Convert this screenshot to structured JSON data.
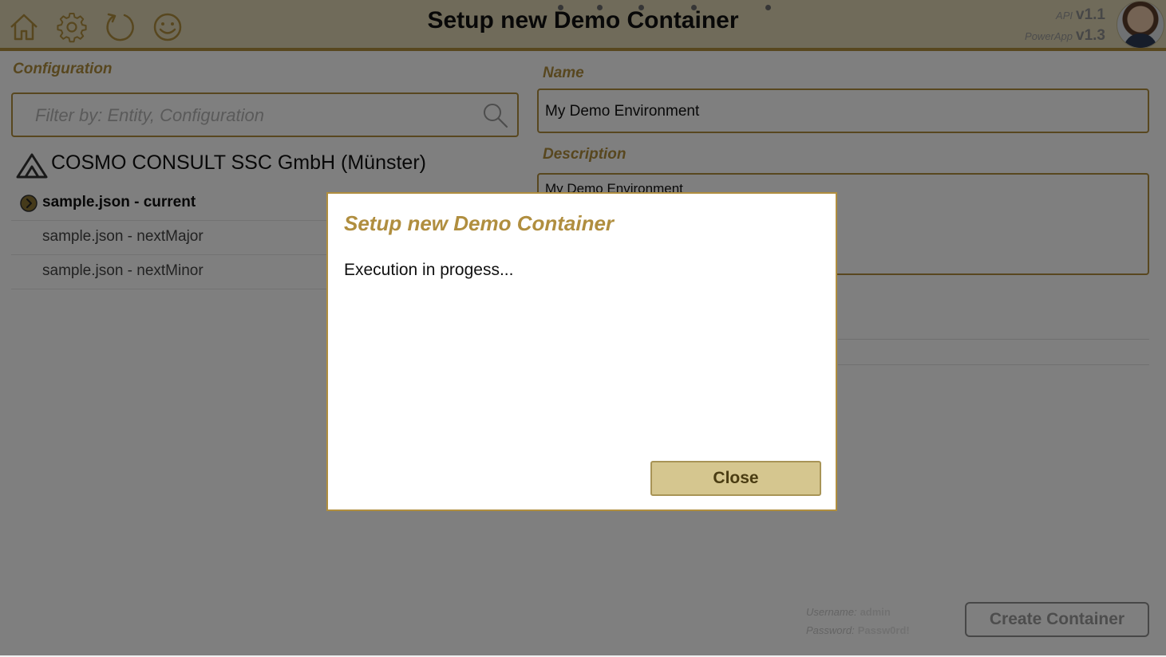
{
  "header": {
    "title": "Setup new Demo Container",
    "icons": [
      "home-icon",
      "gear-icon",
      "refresh-icon",
      "smiley-icon"
    ],
    "api_label": "API",
    "api_version": "v1.1",
    "powerapp_label": "PowerApp",
    "powerapp_version": "v1.3"
  },
  "configuration": {
    "label": "Configuration",
    "filter_placeholder": "Filter by: Entity, Configuration",
    "filter_value": "",
    "company": "COSMO CONSULT SSC GmbH (Münster)",
    "items": [
      {
        "label": "sample.json - current",
        "selected": true
      },
      {
        "label": "sample.json - nextMajor",
        "selected": false
      },
      {
        "label": "sample.json - nextMinor",
        "selected": false
      }
    ]
  },
  "form": {
    "name_label": "Name",
    "name_value": "My Demo Environment",
    "description_label": "Description",
    "description_value": "My Demo Environment"
  },
  "credentials": {
    "username_label": "Username:",
    "username_value": "admin",
    "password_label": "Password:",
    "password_value": "Passw0rd!"
  },
  "create_button": "Create Container",
  "dialog": {
    "title": "Setup new Demo Container",
    "message": "Execution in progess...",
    "close_label": "Close"
  },
  "colors": {
    "accent": "#b08e3f",
    "header_bg": "#e0d7b4",
    "button_bg": "#d5c68f"
  }
}
